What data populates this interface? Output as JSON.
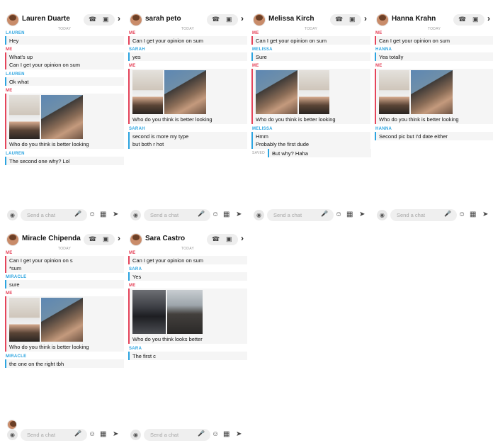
{
  "common": {
    "today": "TODAY",
    "saved": "SAVED",
    "input_placeholder": "Send a chat",
    "icons": [
      "camera-icon",
      "phone-icon",
      "video-icon",
      "chevron-right-icon",
      "mic-icon",
      "emoji-icon",
      "sticker-icon",
      "rocket-icon"
    ],
    "colors": {
      "me": "#e5445a",
      "them": "#2ba4e0"
    }
  },
  "chats": [
    {
      "contact": "Lauren Duarte",
      "messages": [
        {
          "sender": "LAUREN",
          "lines": [
            "Hey"
          ]
        },
        {
          "sender": "ME",
          "lines": [
            "What's up",
            "Can I get your opinion on sum"
          ]
        },
        {
          "sender": "LAUREN",
          "lines": [
            "Ok what"
          ]
        },
        {
          "sender": "ME",
          "lines": [
            "Who do you think is better looking"
          ]
        },
        {
          "sender": "LAUREN",
          "lines": [
            "The second one why? Lol"
          ]
        }
      ]
    },
    {
      "contact": "sarah peto",
      "messages": [
        {
          "sender": "ME",
          "lines": [
            "Can I get your opinion on sum"
          ]
        },
        {
          "sender": "SARAH",
          "lines": [
            "yes"
          ]
        },
        {
          "sender": "ME",
          "lines": [
            "Who do you think is better looking"
          ]
        },
        {
          "sender": "SARAH",
          "lines": [
            "second is more my type",
            "but both r hot"
          ]
        }
      ]
    },
    {
      "contact": "Melissa Kirch",
      "messages": [
        {
          "sender": "ME",
          "lines": [
            "Can I get your opinion on sum"
          ]
        },
        {
          "sender": "MELISSA",
          "lines": [
            "Sure"
          ]
        },
        {
          "sender": "ME",
          "lines": [
            "Who do you think is better looking"
          ]
        },
        {
          "sender": "MELISSA",
          "lines": [
            "Hmm",
            "Probably the first dude",
            "But why? Haha"
          ]
        }
      ]
    },
    {
      "contact": "Hanna Krahn",
      "messages": [
        {
          "sender": "ME",
          "lines": [
            "Can I get your opinion on sum"
          ]
        },
        {
          "sender": "HANNA",
          "lines": [
            "Yea totally"
          ]
        },
        {
          "sender": "ME",
          "lines": [
            "Who do you think is better looking"
          ]
        },
        {
          "sender": "HANNA",
          "lines": [
            "Second pic but I'd date either"
          ]
        }
      ]
    },
    {
      "contact": "Miracle Chipenda",
      "messages": [
        {
          "sender": "ME",
          "lines": [
            "Can I get your opinion on s",
            "*sum"
          ]
        },
        {
          "sender": "MIRACLE",
          "lines": [
            "sure"
          ]
        },
        {
          "sender": "ME",
          "lines": [
            "Who do you think is better looking"
          ]
        },
        {
          "sender": "MIRACLE",
          "lines": [
            "the one on the right tbh"
          ]
        }
      ]
    },
    {
      "contact": "Sara Castro",
      "messages": [
        {
          "sender": "ME",
          "lines": [
            "Can I get your opinion on sum"
          ]
        },
        {
          "sender": "SARA",
          "lines": [
            "Yes"
          ]
        },
        {
          "sender": "ME",
          "lines": [
            "Who do you think looks better"
          ]
        },
        {
          "sender": "SARA",
          "lines": [
            "The first c"
          ]
        }
      ]
    }
  ]
}
